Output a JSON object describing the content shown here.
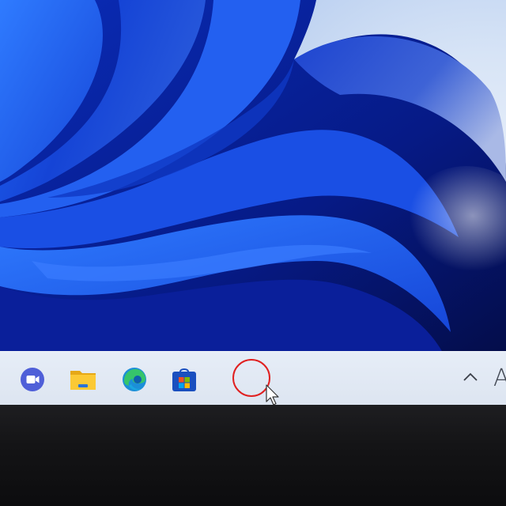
{
  "wallpaper": {
    "name": "windows-11-bloom",
    "colors": {
      "accent": "#1a57e6",
      "deep": "#06156e",
      "light": "#dfe8f5"
    }
  },
  "taskbar": {
    "background": "#e2e9f4",
    "pinned_apps": [
      {
        "name": "teams-chat",
        "icon": "meet-now-icon"
      },
      {
        "name": "file-explorer",
        "icon": "folder-icon"
      },
      {
        "name": "microsoft-edge",
        "icon": "edge-icon"
      },
      {
        "name": "microsoft-store",
        "icon": "store-icon"
      }
    ],
    "highlight_ring_color": "#e02020",
    "tray": {
      "overflow_icon": "chevron-up-icon",
      "text": "A"
    }
  }
}
